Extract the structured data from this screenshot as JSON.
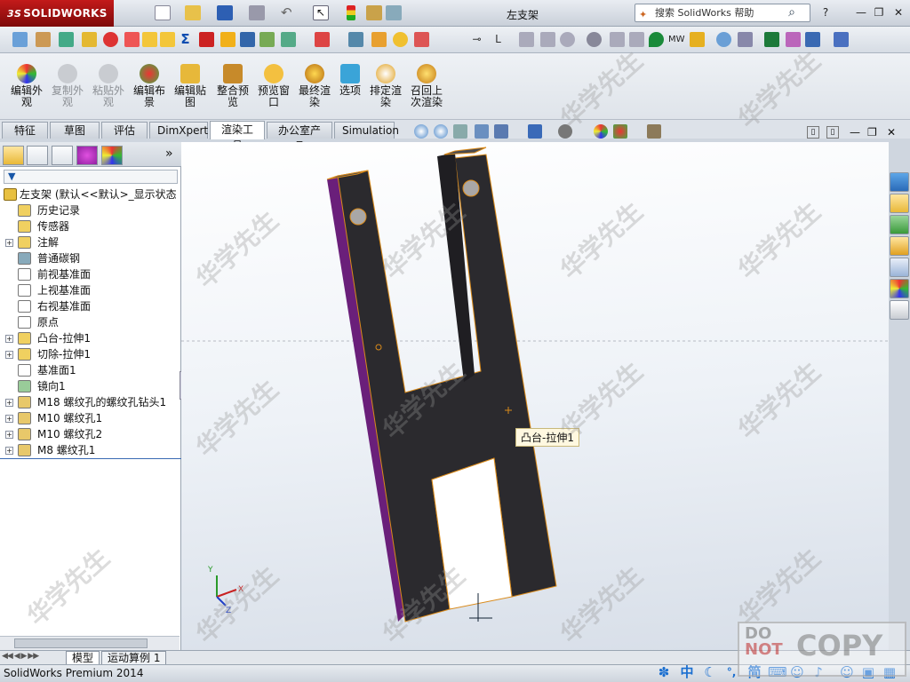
{
  "app": {
    "brand": "SOLIDWORKS",
    "brand_prefix": "3S",
    "document_title": "左支架"
  },
  "help_search": {
    "placeholder": "搜索 SolidWorks 帮助"
  },
  "ribbon": {
    "buttons": [
      {
        "label": "编辑外观",
        "enabled": true,
        "icon": "appearance-icon"
      },
      {
        "label": "复制外观",
        "enabled": false,
        "icon": "copy-appearance-icon"
      },
      {
        "label": "粘贴外观",
        "enabled": false,
        "icon": "paste-appearance-icon"
      },
      {
        "label": "编辑布景",
        "enabled": true,
        "icon": "scene-icon"
      },
      {
        "label": "编辑贴图",
        "enabled": true,
        "icon": "decal-icon"
      },
      {
        "label": "整合预览",
        "enabled": true,
        "icon": "integrated-preview-icon"
      },
      {
        "label": "预览窗口",
        "enabled": true,
        "icon": "preview-window-icon"
      },
      {
        "label": "最终渲染",
        "enabled": true,
        "icon": "final-render-icon"
      },
      {
        "label": "选项",
        "enabled": true,
        "icon": "options-icon"
      },
      {
        "label": "排定渲染",
        "enabled": true,
        "icon": "schedule-render-icon"
      },
      {
        "label": "召回上次渲染",
        "enabled": true,
        "icon": "recall-render-icon"
      }
    ]
  },
  "command_tabs": [
    {
      "label": "特征",
      "active": false
    },
    {
      "label": "草图",
      "active": false
    },
    {
      "label": "评估",
      "active": false
    },
    {
      "label": "DimXpert",
      "active": false
    },
    {
      "label": "渲染工具",
      "active": true
    },
    {
      "label": "办公室产品",
      "active": false
    },
    {
      "label": "Simulation",
      "active": false
    }
  ],
  "tree": {
    "filter_icon": "filter-icon",
    "root": "左支架 (默认<<默认>_显示状态",
    "items": [
      {
        "label": "历史记录",
        "expandable": false,
        "icon": "history-icon"
      },
      {
        "label": "传感器",
        "expandable": false,
        "icon": "sensor-icon"
      },
      {
        "label": "注解",
        "expandable": true,
        "icon": "annotation-icon"
      },
      {
        "label": "普通碳钢",
        "expandable": false,
        "icon": "material-icon"
      },
      {
        "label": "前视基准面",
        "expandable": false,
        "icon": "plane-icon"
      },
      {
        "label": "上视基准面",
        "expandable": false,
        "icon": "plane-icon"
      },
      {
        "label": "右视基准面",
        "expandable": false,
        "icon": "plane-icon"
      },
      {
        "label": "原点",
        "expandable": false,
        "icon": "origin-icon"
      },
      {
        "label": "凸台-拉伸1",
        "expandable": true,
        "icon": "extrude-icon"
      },
      {
        "label": "切除-拉伸1",
        "expandable": true,
        "icon": "cut-icon"
      },
      {
        "label": "基准面1",
        "expandable": false,
        "icon": "plane-icon"
      },
      {
        "label": "镜向1",
        "expandable": false,
        "icon": "mirror-icon"
      },
      {
        "label": "M18 螺纹孔的螺纹孔钻头1",
        "expandable": true,
        "icon": "hole-icon"
      },
      {
        "label": "M10 螺纹孔1",
        "expandable": true,
        "icon": "hole-icon"
      },
      {
        "label": "M10 螺纹孔2",
        "expandable": true,
        "icon": "hole-icon"
      },
      {
        "label": "M8 螺纹孔1",
        "expandable": true,
        "icon": "hole-icon"
      }
    ]
  },
  "viewport": {
    "tooltip": "凸台-拉伸1",
    "triad_y": "Y",
    "triad_x": "X",
    "triad_z": "Z"
  },
  "bottom_tabs": [
    "模型",
    "运动算例 1"
  ],
  "status": {
    "text": "SolidWorks Premium 2014"
  },
  "tray": {
    "ime_lang": "中",
    "ime_mode": "简"
  },
  "watermark": {
    "text": "华学先生",
    "stamp_line1": "DO",
    "stamp_line2": "NOT",
    "stamp_word": "COPY"
  },
  "colors": {
    "brand_red": "#b91818",
    "part_face": "#2b2a2e",
    "part_side": "#6a1f7a",
    "edge": "#d98a1a"
  }
}
